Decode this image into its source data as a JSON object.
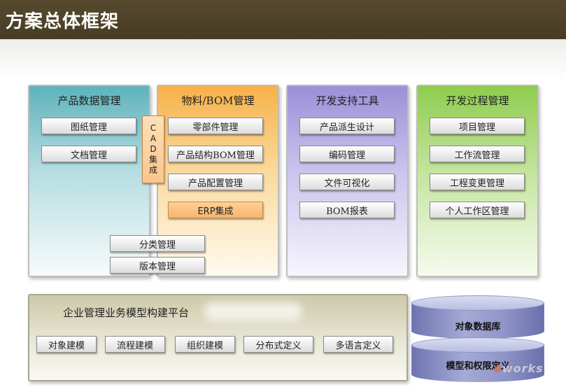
{
  "header": {
    "title": "方案总体框架"
  },
  "panels": [
    {
      "title": "产品数据管理",
      "items": [
        "图纸管理",
        "文档管理"
      ]
    },
    {
      "title": "物料/BOM管理",
      "items": [
        "零部件管理",
        "产品结构BOM管理",
        "产品配置管理"
      ],
      "highlight": "ERP集成"
    },
    {
      "title": "开发支持工具",
      "items": [
        "产品派生设计",
        "编码管理",
        "文件可视化",
        "BOM报表"
      ]
    },
    {
      "title": "开发过程管理",
      "items": [
        "项目管理",
        "工作流管理",
        "工程变更管理",
        "个人工作区管理"
      ]
    }
  ],
  "cad": {
    "chars": [
      "C",
      "A",
      "D",
      "集",
      "成"
    ]
  },
  "shared": [
    "分类管理",
    "版本管理"
  ],
  "platform": {
    "title": "企业管理业务模型构建平台",
    "items": [
      "对象建模",
      "流程建模",
      "组织建模",
      "分布式定义",
      "多语言定义"
    ]
  },
  "databases": [
    "对象数据库",
    "模型和权限定义"
  ],
  "watermark": {
    "prefix": "e",
    "text": "works"
  },
  "colors": {
    "header": "#4d4128",
    "panel_teal": "#5fb3bb",
    "panel_orange": "#f6b24a",
    "panel_purple": "#9c8fd7",
    "panel_green": "#8fcc4f",
    "platform": "#cdc9a9",
    "database": "#8f95c8",
    "highlight_button": "#f9b56b"
  }
}
